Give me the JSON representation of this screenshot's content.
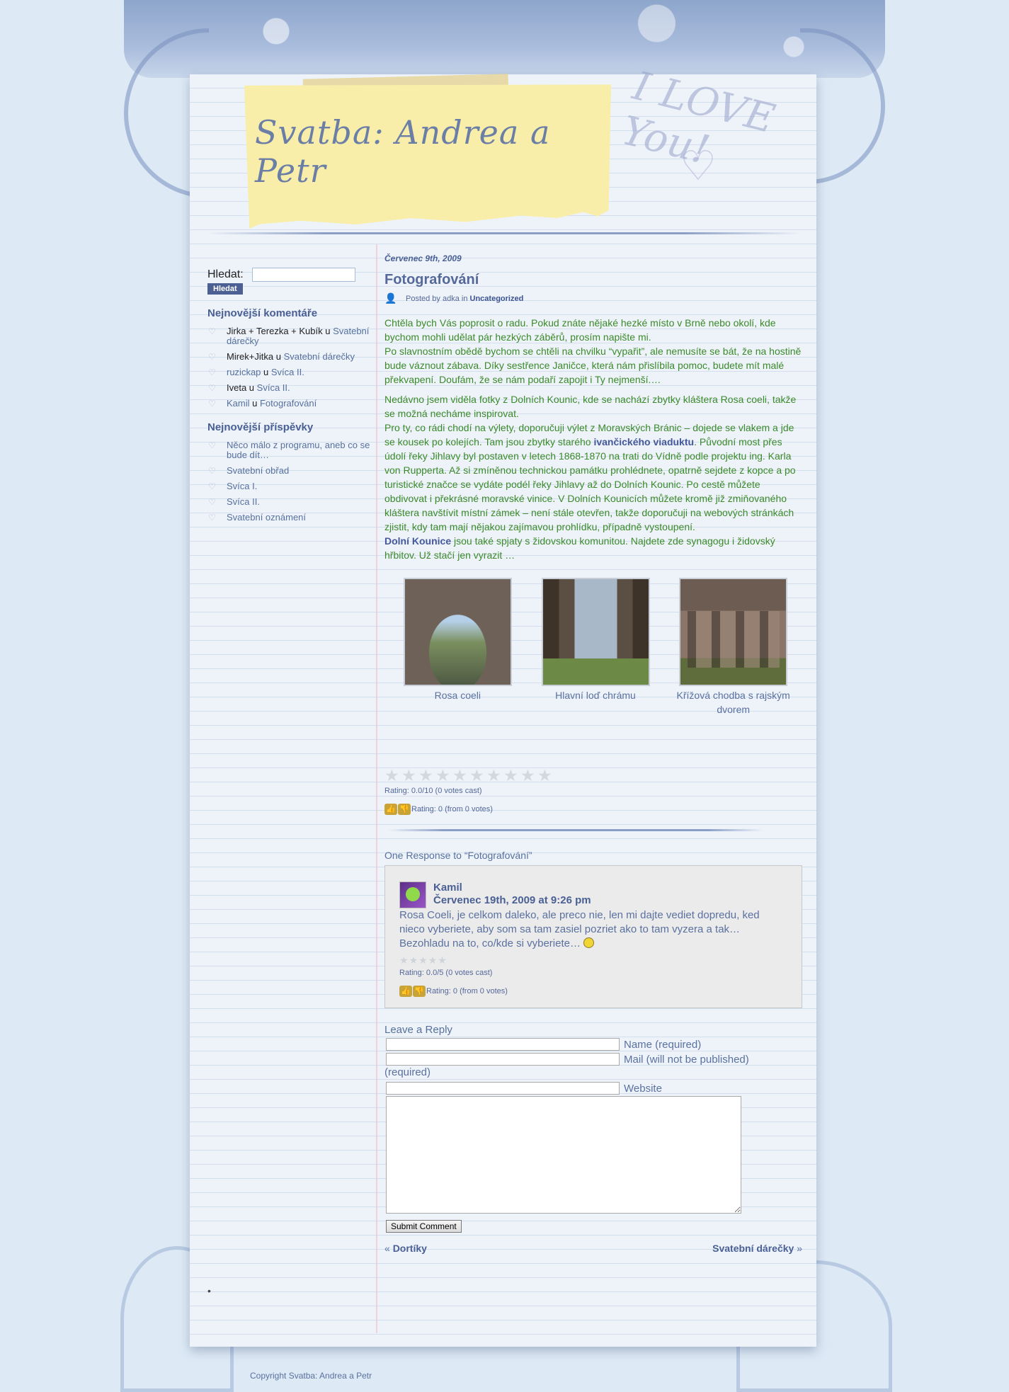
{
  "header": {
    "site_title": "Svatba: Andrea a Petr",
    "love_text": "I LOVE You!"
  },
  "sidebar": {
    "search_label": "Hledat:",
    "search_value": "",
    "search_button": "Hledat",
    "recent_comments_heading": "Nejnovější komentáře",
    "recent_comments": [
      {
        "author": "Jirka + Terezka + Kubík",
        "sep": " u ",
        "post": "Svatební dárečky"
      },
      {
        "author": "Mirek+Jitka",
        "sep": " u ",
        "post": "Svatební dárečky"
      },
      {
        "author": "ruzickap",
        "sep": " u ",
        "post": "Svíca II."
      },
      {
        "author": "Iveta",
        "sep": " u ",
        "post": "Svíca II."
      },
      {
        "author": "Kamil",
        "sep": " u ",
        "post": "Fotografování"
      }
    ],
    "recent_posts_heading": "Nejnovější příspěvky",
    "recent_posts": [
      "Něco málo z programu, aneb co se bude dít…",
      "Svatební obřad",
      "Svíca I.",
      "Svíca II.",
      "Svatební oznámení"
    ]
  },
  "post": {
    "date": "Červenec 9th, 2009",
    "title": "Fotografování",
    "meta_prefix": "Posted by adka in",
    "category": "Uncategorized",
    "p1": "Chtěla bych Vás poprosit o radu. Pokud znáte nějaké hezké místo v Brně nebo okolí, kde bychom mohli udělat pár hezkých záběrů, prosím napište mi.",
    "p2": "Po slavnostním obědě bychom se chtěli na chvilku “vypařit”, ale nemusíte se bát, že na hostině bude váznout zábava. Díky sestřence Janičce, která nám přislíbila pomoc, budete mít malé překvapení. Doufám, že se nám podaří zapojit i Ty nejmenší.…",
    "p3": "Nedávno jsem viděla fotky z Dolních Kounic, kde se nachází zbytky kláštera Rosa coeli, takže se možná necháme inspirovat.",
    "p4_a": "Pro ty, co rádi chodí na výlety, doporučuji výlet z Moravských Bránic – dojede se vlakem a jde se kousek po kolejích. Tam jsou zbytky starého ",
    "p4_link": "ivančického viaduktu",
    "p4_b": ". Původní most přes údolí řeky Jihlavy byl postaven v letech 1868-1870 na trati do Vídně podle projektu ing. Karla von Rupperta. Až si zmíněnou technickou památku prohlédnete, opatrně sejdete z kopce a po turistické značce se vydáte podél řeky Jihlavy až do Dolních Kounic. Po cestě můžete obdivovat i překrásné moravské vinice. V Dolních Kounicích můžete kromě již zmiňovaného kláštera navštívit místní zámek – není stále otevřen, takže doporučuji na webových stránkách zjistit, kdy tam mají nějakou zajímavou prohlídku, případně vystoupení.",
    "p5_link": "Dolní Kounice",
    "p5_b": " jsou také spjaty s židovskou komunitou. Najdete zde synagogu i židovský hřbitov. Už stačí jen vyrazit …",
    "gallery": [
      {
        "caption": "Rosa coeli"
      },
      {
        "caption": "Hlavní loď chrámu"
      },
      {
        "caption": "Křížová chodba s rajským dvorem"
      }
    ],
    "rating_text": "Rating: 0.0/10 (0 votes cast)",
    "thumbs_text": "Rating: 0 (from 0 votes)"
  },
  "comments": {
    "heading": "One Response to “Fotografování”",
    "items": [
      {
        "author": "Kamil",
        "date": "Červenec 19th, 2009 at 9:26 pm",
        "text": "Rosa Coeli, je celkom daleko, ale preco nie, len mi dajte vediet dopredu, ked nieco vyberiete, aby som sa tam zasiel pozriet ako to tam vyzera a tak… Bezohladu na to, co/kde si vyberiete…",
        "rating_text": "Rating: 0.0/5 (0 votes cast)",
        "thumbs_text": "Rating: 0 (from 0 votes)"
      }
    ]
  },
  "reply_form": {
    "heading": "Leave a Reply",
    "name_label": "Name (required)",
    "mail_label": "Mail (will not be published)",
    "mail_label_2": "(required)",
    "website_label": "Website",
    "submit": "Submit Comment"
  },
  "post_nav": {
    "prev_arrow": "«",
    "prev": "Dortíky",
    "next": "Svatební dárečky",
    "next_arrow": "»"
  },
  "footer": {
    "copyright": "Copyright Svatba: Andrea a Petr"
  },
  "colors": {
    "accent": "#4a5f94",
    "body_green": "#3a8a2a",
    "paper": "#eef3f9",
    "note_yellow": "#f8eeaa"
  }
}
